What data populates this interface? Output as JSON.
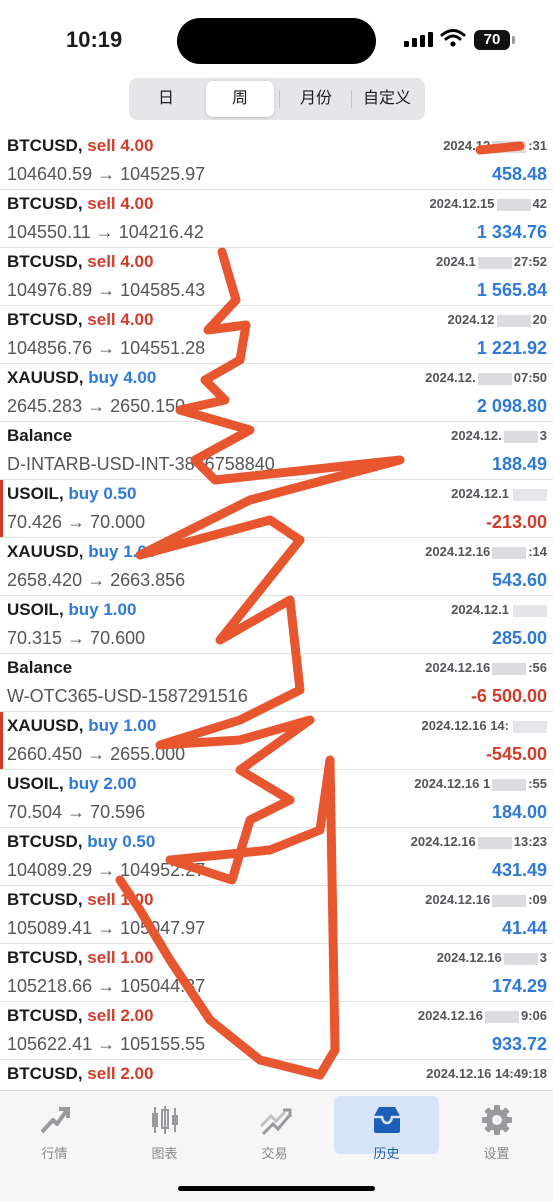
{
  "status": {
    "time": "10:19",
    "battery": "70"
  },
  "period_tabs": [
    "日",
    "周",
    "月份",
    "自定义"
  ],
  "deals": [
    {
      "symbol": "BTCUSD",
      "side": "sell 4.00",
      "type": "sell",
      "date": "2024.12",
      "date_end": ":31",
      "price": "104640.59 → 104525.97",
      "profit": "458.48",
      "sign": "pos"
    },
    {
      "symbol": "BTCUSD",
      "side": "sell 4.00",
      "type": "sell",
      "date": "2024.12.15",
      "date_end": "42",
      "price": "104550.11 → 104216.42",
      "profit": "1 334.76",
      "sign": "pos"
    },
    {
      "symbol": "BTCUSD",
      "side": "sell 4.00",
      "type": "sell",
      "date": "2024.1",
      "date_end": "27:52",
      "price": "104976.89 → 104585.43",
      "profit": "1 565.84",
      "sign": "pos"
    },
    {
      "symbol": "BTCUSD",
      "side": "sell 4.00",
      "type": "sell",
      "date": "2024.12",
      "date_end": "20",
      "price": "104856.76 → 104551.28",
      "profit": "1 221.92",
      "sign": "pos"
    },
    {
      "symbol": "XAUUSD",
      "side": "buy 4.00",
      "type": "buy",
      "date": "2024.12.",
      "date_end": "07:50",
      "price": "2645.283 → 2650.150",
      "profit": "2 098.80",
      "sign": "pos"
    },
    {
      "symbol": "Balance",
      "side": "",
      "type": "none",
      "date": "2024.12.",
      "date_end": "3",
      "price": "D-INTARB-USD-INT-3876758840",
      "profit": "188.49",
      "sign": "pos"
    },
    {
      "symbol": "USOIL",
      "side": "buy 0.50",
      "type": "buy",
      "date": "2024.12.1",
      "date_end": "",
      "price": "70.426 → 70.000",
      "profit": "-213.00",
      "sign": "neg",
      "marked": true
    },
    {
      "symbol": "XAUUSD",
      "side": "buy 1.00",
      "type": "buy",
      "date": "2024.12.16",
      "date_end": ":14",
      "price": "2658.420 → 2663.856",
      "profit": "543.60",
      "sign": "pos"
    },
    {
      "symbol": "USOIL",
      "side": "buy 1.00",
      "type": "buy",
      "date": "2024.12.1",
      "date_end": "",
      "price": "70.315 → 70.600",
      "profit": "285.00",
      "sign": "pos"
    },
    {
      "symbol": "Balance",
      "side": "",
      "type": "none",
      "date": "2024.12.16",
      "date_end": ":56",
      "price": "W-OTC365-USD-1587291516",
      "profit": "-6 500.00",
      "sign": "neg"
    },
    {
      "symbol": "XAUUSD",
      "side": "buy 1.00",
      "type": "buy",
      "date": "2024.12.16 14:",
      "date_end": "",
      "price": "2660.450 → 2655.000",
      "profit": "-545.00",
      "sign": "neg",
      "marked": true
    },
    {
      "symbol": "USOIL",
      "side": "buy 2.00",
      "type": "buy",
      "date": "2024.12.16 1",
      "date_end": ":55",
      "price": "70.504 → 70.596",
      "profit": "184.00",
      "sign": "pos"
    },
    {
      "symbol": "BTCUSD",
      "side": "buy 0.50",
      "type": "buy",
      "date": "2024.12.16",
      "date_end": "13:23",
      "price": "104089.29 → 104952.27",
      "profit": "431.49",
      "sign": "pos"
    },
    {
      "symbol": "BTCUSD",
      "side": "sell 1.00",
      "type": "sell",
      "date": "2024.12.16",
      "date_end": ":09",
      "price": "105089.41 → 105047.97",
      "profit": "41.44",
      "sign": "pos"
    },
    {
      "symbol": "BTCUSD",
      "side": "sell 1.00",
      "type": "sell",
      "date": "2024.12.16",
      "date_end": "3",
      "price": "105218.66 → 105044.37",
      "profit": "174.29",
      "sign": "pos"
    },
    {
      "symbol": "BTCUSD",
      "side": "sell 2.00",
      "type": "sell",
      "date": "2024.12.16",
      "date_end": "9:06",
      "price": "105622.41 → 105155.55",
      "profit": "933.72",
      "sign": "pos"
    },
    {
      "symbol": "BTCUSD",
      "side": "sell 2.00",
      "type": "sell",
      "date": "2024.12.16 14:49:18",
      "date_end": "",
      "price": "",
      "profit": "",
      "sign": "pos",
      "partial": true
    }
  ],
  "bottom_tabs": [
    {
      "label": "行情",
      "icon": "trend-arrow-icon"
    },
    {
      "label": "图表",
      "icon": "candlestick-icon"
    },
    {
      "label": "交易",
      "icon": "trade-chart-icon"
    },
    {
      "label": "历史",
      "icon": "inbox-tray-icon",
      "active": true
    },
    {
      "label": "设置",
      "icon": "gear-icon"
    }
  ],
  "colors": {
    "sell": "#d23c2a",
    "buy": "#2f7ad9",
    "accent": "#1c5fb6",
    "scribble": "#e8562f"
  }
}
